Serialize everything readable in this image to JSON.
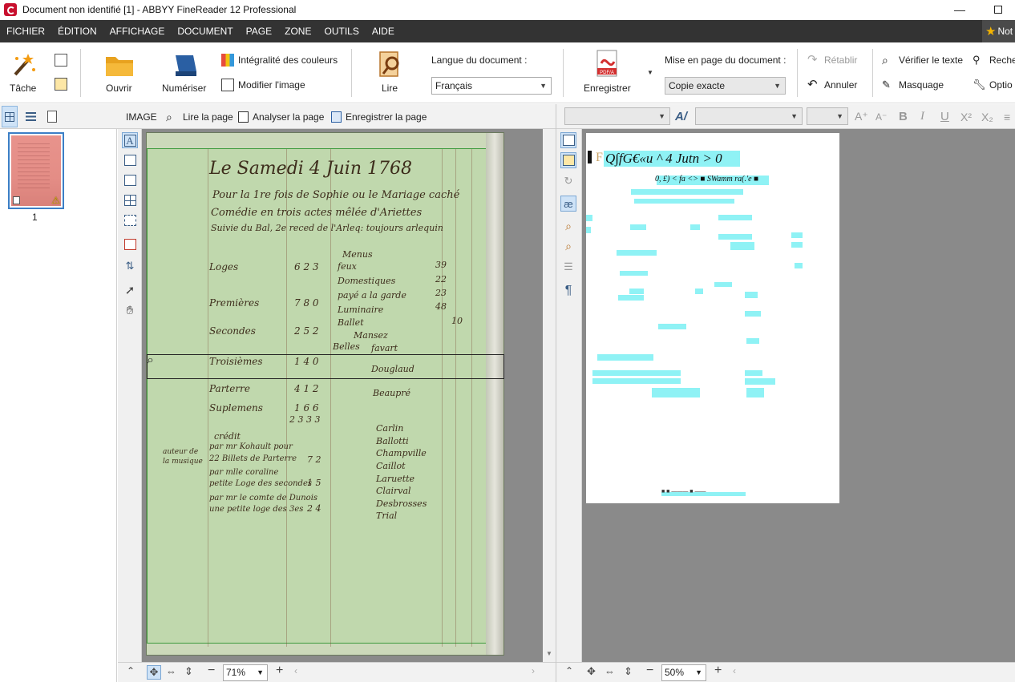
{
  "window": {
    "title": "Document non identifié [1] - ABBYY FineReader 12 Professional",
    "minimize_glyph": "—"
  },
  "menu": [
    "FICHIER",
    "ÉDITION",
    "AFFICHAGE",
    "DOCUMENT",
    "PAGE",
    "ZONE",
    "OUTILS",
    "AIDE"
  ],
  "notification_label": "Not",
  "ribbon": {
    "task_label": "Tâche",
    "open_label": "Ouvrir",
    "scan_label": "Numériser",
    "full_color_label": "Intégralité des couleurs",
    "edit_image_label": "Modifier l'image",
    "read_label": "Lire",
    "language_label": "Langue du document :",
    "language_value": "Français",
    "save_label": "Enregistrer",
    "pdf_badge": "PDF/A",
    "layout_label": "Mise en page du document :",
    "layout_value": "Copie exacte",
    "redo_label": "Rétablir",
    "undo_label": "Annuler",
    "verify_label": "Vérifier le texte",
    "mask_label": "Masquage",
    "search_label": "Reche",
    "options_label": "Optio"
  },
  "image_toolbar": {
    "image_label": "IMAGE",
    "read_page_label": "Lire la page",
    "analyze_page_label": "Analyser la page",
    "save_page_label": "Enregistrer la page"
  },
  "pages": [
    {
      "number": "1"
    }
  ],
  "document_image": {
    "lines": [
      {
        "text": "Le Samedi 4 Juin 1768"
      },
      {
        "text": "Pour la 1re fois de Sophie ou le Mariage caché"
      },
      {
        "text": "Comédie en trois actes mêlée d'Ariettes"
      },
      {
        "text": "Suivie du Bal, 2e reced de l'Arleq: toujours arlequin"
      },
      {
        "text": "Loges"
      },
      {
        "text": "6 2 3"
      },
      {
        "text": "Premières"
      },
      {
        "text": "7 8 0"
      },
      {
        "text": "Secondes"
      },
      {
        "text": "2 5 2"
      },
      {
        "text": "Troisièmes"
      },
      {
        "text": "1 4 0"
      },
      {
        "text": "Parterre"
      },
      {
        "text": "4 1 2"
      },
      {
        "text": "Suplemens"
      },
      {
        "text": "1 6 6"
      },
      {
        "text": "2 3 3 3"
      },
      {
        "text": "Menus"
      },
      {
        "text": "feux"
      },
      {
        "text": "Domestiques"
      },
      {
        "text": "payé a la garde"
      },
      {
        "text": "Luminaire"
      },
      {
        "text": "Ballet"
      },
      {
        "text": "Mansez"
      },
      {
        "text": "Belles"
      },
      {
        "text": "favart"
      },
      {
        "text": "Douglaud"
      },
      {
        "text": "Beaupré"
      },
      {
        "text": "Carlin"
      },
      {
        "text": "Ballotti"
      },
      {
        "text": "Champville"
      },
      {
        "text": "Caillot"
      },
      {
        "text": "Laruette"
      },
      {
        "text": "Clairval"
      },
      {
        "text": "Desbrosses"
      },
      {
        "text": "Trial"
      },
      {
        "text": "crédit"
      },
      {
        "text": "par mr Kohault pour"
      },
      {
        "text": "22 Billets de Parterre"
      },
      {
        "text": "7 2"
      },
      {
        "text": "par mlle coraline"
      },
      {
        "text": "petite Loge des secondes"
      },
      {
        "text": "1 5"
      },
      {
        "text": "par mr le comte de Dunois"
      },
      {
        "text": "une petite loge des 3es"
      },
      {
        "text": "2 4"
      },
      {
        "text": "auteur de la musique"
      },
      {
        "text": "39"
      },
      {
        "text": "22"
      },
      {
        "text": "23"
      },
      {
        "text": "48"
      },
      {
        "text": "10"
      }
    ]
  },
  "text_editor": {
    "heading": "Q∫fG€«u ^ 4 Jutn > 0",
    "line2": "0, £) < fa <> ■ SWamm ra(.'e ■",
    "footer": "■ ■ ——— ■ ——"
  },
  "zoom": {
    "image_zoom": "71%",
    "text_zoom": "50%"
  },
  "colors": {
    "menubar": "#333333",
    "zone_green": "#3d9a3d",
    "text_highlight": "#8ff2f5",
    "thumb_border": "#3c7fc6"
  }
}
